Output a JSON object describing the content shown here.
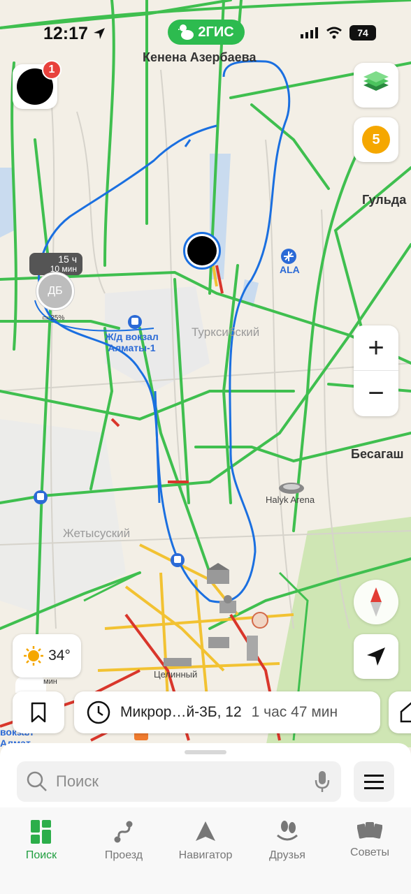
{
  "status_bar": {
    "time": "12:17",
    "brand": "2ГИС",
    "battery": "74"
  },
  "map": {
    "labels": {
      "street_top": "Кенена Азербаева",
      "gulda": "Гульда",
      "besagash": "Бесагаш",
      "turksib": "Турксибский",
      "zhetysu": "Жетысуский",
      "celinny": "Целинный",
      "ala": "ALA",
      "station": "Ж/д вокзал\nАлматы-1",
      "halyk": "Halyk Arena",
      "station_bottom": "вокзал\nАлмат"
    },
    "friend": {
      "time_main": "15 ч",
      "time_sub": "10 мин",
      "initials": "ДБ",
      "battery": "25%"
    },
    "avatar_badge": "1",
    "layers_count": "5",
    "weather": "34°",
    "mini_label": "мин"
  },
  "route": {
    "address": "Микрор…й-3Б, 12",
    "duration": "1 час 47 мин"
  },
  "search": {
    "placeholder": "Поиск"
  },
  "tabs": [
    {
      "label": "Поиск",
      "icon": "grid-icon",
      "active": true
    },
    {
      "label": "Проезд",
      "icon": "route-icon"
    },
    {
      "label": "Навигатор",
      "icon": "navigator-icon"
    },
    {
      "label": "Друзья",
      "icon": "friends-icon"
    },
    {
      "label": "Советы",
      "icon": "cards-icon"
    }
  ],
  "colors": {
    "brand_green": "#2dbb4f",
    "route_blue": "#1a6fe0",
    "traffic_green": "#3fbf4f",
    "traffic_red": "#d9362b",
    "traffic_yellow": "#f2c232"
  }
}
